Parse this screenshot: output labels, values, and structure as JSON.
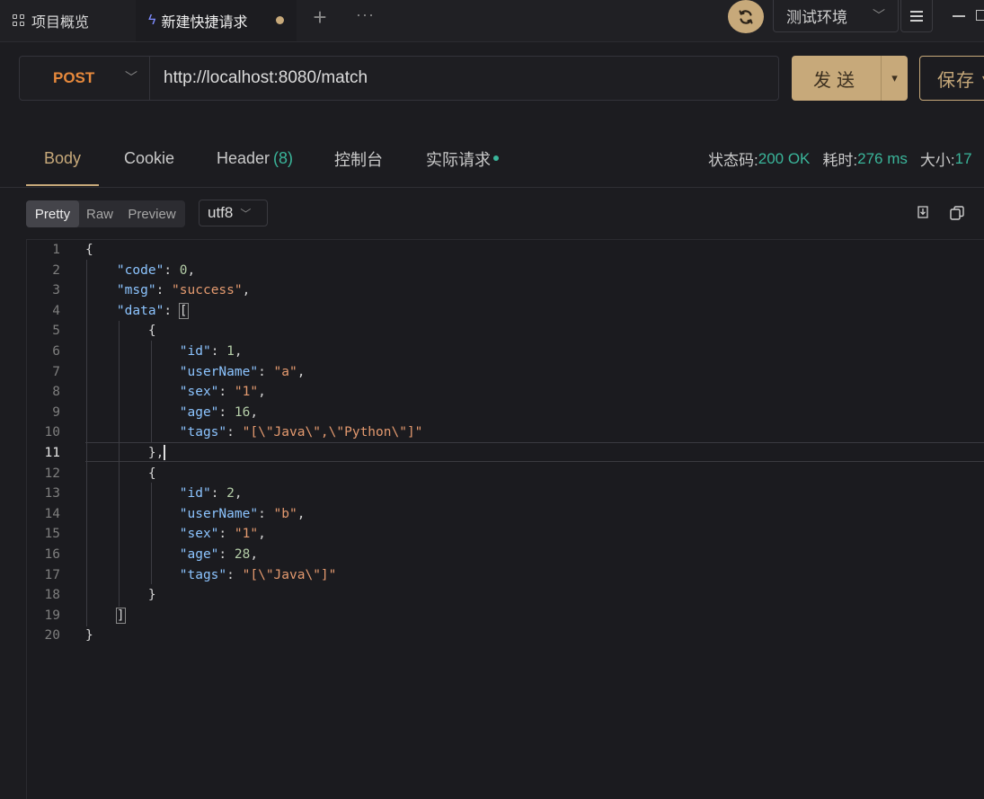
{
  "tabs": {
    "overview_label": "项目概览",
    "active_label": "新建快捷请求",
    "plus": "+",
    "more": "···"
  },
  "env": {
    "label": "测试环境"
  },
  "request": {
    "method": "POST",
    "url": "http://localhost:8080/match",
    "send_label": "发送",
    "save_label": "保存"
  },
  "response_tabs": {
    "body": "Body",
    "cookie": "Cookie",
    "header": "Header",
    "header_count": "(8)",
    "console": "控制台",
    "actual_request": "实际请求"
  },
  "stats": {
    "status_label": "状态码:",
    "status_value": "200 OK",
    "time_label": "耗时:",
    "time_value": "276 ms",
    "size_label": "大小:",
    "size_value": "17"
  },
  "view": {
    "pretty": "Pretty",
    "raw": "Raw",
    "preview": "Preview",
    "encoding": "utf8"
  },
  "code": {
    "line_numbers": [
      "1",
      "2",
      "3",
      "4",
      "5",
      "6",
      "7",
      "8",
      "9",
      "10",
      "11",
      "12",
      "13",
      "14",
      "15",
      "16",
      "17",
      "18",
      "19",
      "20"
    ],
    "current_line": 11
  },
  "colors": {
    "accent": "#c7a97a",
    "method": "#e7893c",
    "success": "#3ab59a",
    "json_key": "#8cc4ff",
    "json_string": "#e49a6f",
    "json_number": "#b5cea8"
  }
}
